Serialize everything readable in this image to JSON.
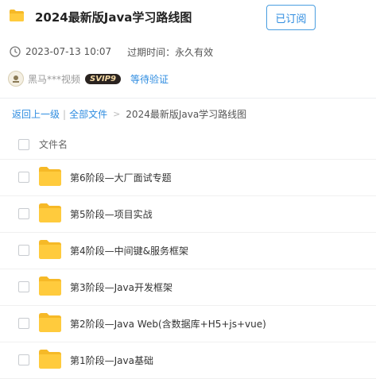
{
  "header": {
    "title": "2024最新版Java学习路线图",
    "subscribe_label": "已订阅"
  },
  "meta": {
    "date": "2023-07-13 10:07",
    "expiry_label": "过期时间：永久有效"
  },
  "author": {
    "name": "黑马***视频",
    "badge": "SVIP9",
    "verify_label": "等待验证"
  },
  "breadcrumb": {
    "back": "返回上一级",
    "separator": "|",
    "all_files": "全部文件",
    "arrow": ">",
    "current": "2024最新版Java学习路线图"
  },
  "list": {
    "header_label": "文件名",
    "items": [
      {
        "name": "第6阶段—大厂面试专题"
      },
      {
        "name": "第5阶段—项目实战"
      },
      {
        "name": "第4阶段—中间键&服务框架"
      },
      {
        "name": "第3阶段—Java开发框架"
      },
      {
        "name": "第2阶段—Java Web(含数据库+H5+js+vue)"
      },
      {
        "name": "第1阶段—Java基础"
      }
    ]
  },
  "colors": {
    "accent": "#2e8ce0",
    "folder": "#ffcb3d"
  }
}
